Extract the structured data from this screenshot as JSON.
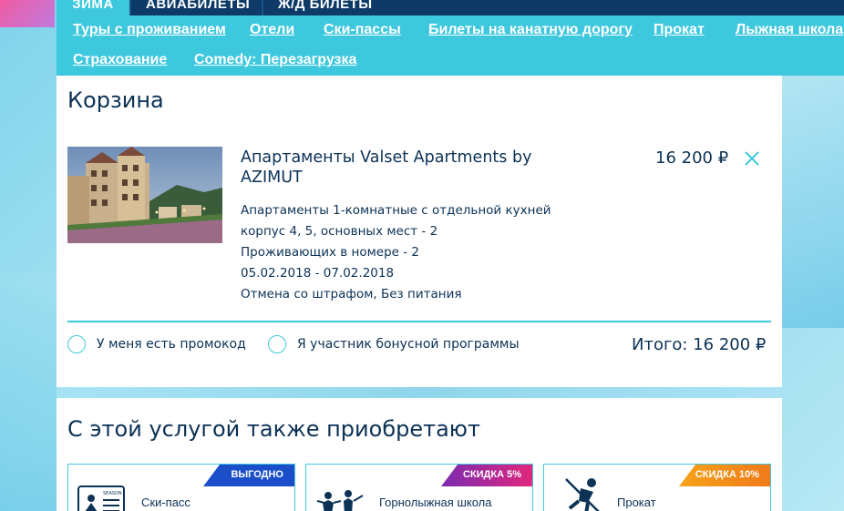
{
  "top_nav": {
    "tabs": [
      {
        "label": "ЗИМА",
        "active": true
      },
      {
        "label": "АВИАБИЛЕТЫ",
        "active": false
      },
      {
        "label": "Ж/Д БИЛЕТЫ",
        "active": false
      }
    ]
  },
  "sub_nav": {
    "links": [
      "Туры с проживанием",
      "Отели",
      "Ски-пассы",
      "Билеты на канатную дорогу",
      "Прокат",
      "Лыжная школа",
      "Страхование",
      "Comedy: Перезагрузка"
    ]
  },
  "cart": {
    "title": "Корзина",
    "item": {
      "title": "Апартаменты Valset Apartments by AZIMUT",
      "details": [
        "Апартаменты 1-комнатные с отдельной кухней",
        "корпус 4, 5, основных мест - 2",
        "Проживающих в номере - 2",
        "05.02.2018 - 07.02.2018",
        "Отмена со штрафом, Без питания"
      ],
      "price": "16 200 ₽"
    },
    "promo_label": "У меня есть промокод",
    "bonus_label": "Я участник бонусной программы",
    "total": "Итого: 16 200 ₽"
  },
  "also_bought": {
    "title": "С этой услугой также приобретают",
    "services": [
      {
        "name": "Ски-пасс",
        "badge": "ВЫГОДНО",
        "badge_color": "#1a4fc9",
        "icon": "season-pass-icon",
        "icon_text": "SEASON"
      },
      {
        "name": "Горнолыжная школа",
        "badge": "СКИДКА 5%",
        "badge_color": "#e0287e",
        "icon": "ski-school-icon"
      },
      {
        "name": "Прокат",
        "badge": "СКИДКА 10%",
        "badge_color": "#f5a31a",
        "icon": "skier-icon"
      }
    ]
  },
  "colors": {
    "accent": "#3ec8de",
    "navy": "#0d3a66",
    "text": "#0c3256"
  }
}
